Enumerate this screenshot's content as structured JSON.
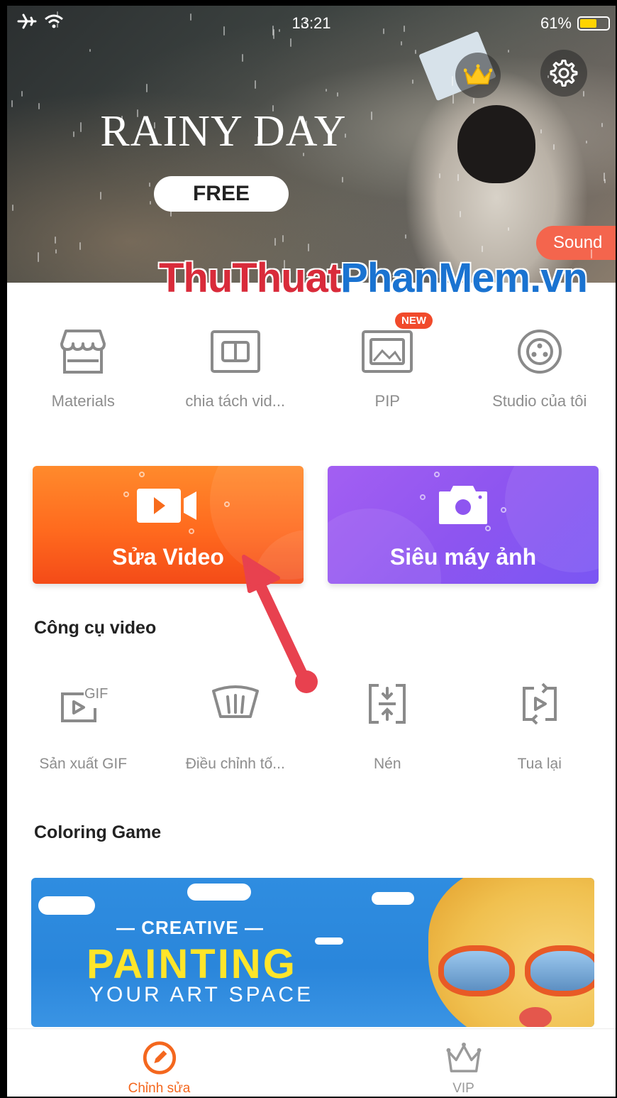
{
  "status_bar": {
    "time": "13:21",
    "battery": "61%",
    "battery_level": 0.61
  },
  "hero": {
    "title": "RAINY DAY",
    "badge": "FREE",
    "tag": "Sound"
  },
  "watermark": {
    "part1": "ThuThuat",
    "part2": "PhanMem.vn"
  },
  "quick_items": [
    {
      "label": "Materials",
      "icon": "store-icon"
    },
    {
      "label": "chia tách vid...",
      "icon": "split-screen-icon"
    },
    {
      "label": "PIP",
      "icon": "picture-in-picture-icon",
      "badge": "NEW"
    },
    {
      "label": "Studio của tôi",
      "icon": "film-reel-icon"
    }
  ],
  "cards": {
    "video": {
      "label": "Sửa Video",
      "icon": "video-camera-icon",
      "color": "#ff6a1e"
    },
    "camera": {
      "label": "Siêu máy ảnh",
      "icon": "camera-icon",
      "color": "#8e55f0"
    }
  },
  "sections": {
    "tools_title": "Công cụ video",
    "game_title": "Coloring Game"
  },
  "tools": [
    {
      "label": "Sản xuất GIF",
      "icon": "gif-icon",
      "icon_text": "GIF"
    },
    {
      "label": "Điều chỉnh tố...",
      "icon": "speed-gauge-icon"
    },
    {
      "label": "Nén",
      "icon": "compress-icon"
    },
    {
      "label": "Tua lại",
      "icon": "reverse-icon"
    }
  ],
  "coloring_banner": {
    "line1": "— CREATIVE —",
    "line2": "PAINTING",
    "line3": "YOUR ART SPACE"
  },
  "bottom_nav": [
    {
      "label": "Chỉnh sửa",
      "icon": "pencil-circle-icon",
      "active": true
    },
    {
      "label": "VIP",
      "icon": "crown-icon",
      "active": false
    }
  ],
  "colors": {
    "accent": "#f4671e",
    "purple": "#8e55f0",
    "badge_red": "#f14a2b"
  }
}
